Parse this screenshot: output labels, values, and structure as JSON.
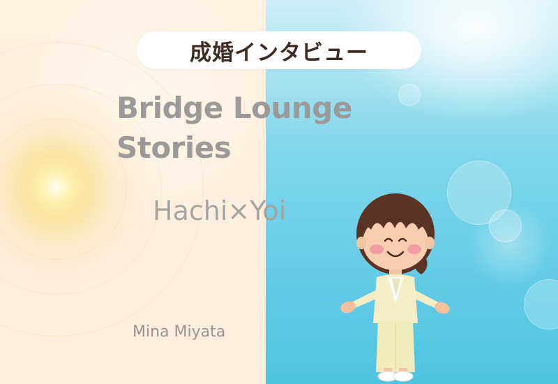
{
  "badge": {
    "label": "成婚インタビュー"
  },
  "title": {
    "line1": "Bridge Lounge",
    "line2": "Stories"
  },
  "couple": "Hachi×Yoi",
  "author": "Mina Miyata",
  "colors": {
    "badge_text": "#3d2b23",
    "title_text": "#9c9a99",
    "left_background": "#fdeedd",
    "right_background": "#4ec4e1"
  },
  "illustration": {
    "icon": "girl-character-icon"
  }
}
